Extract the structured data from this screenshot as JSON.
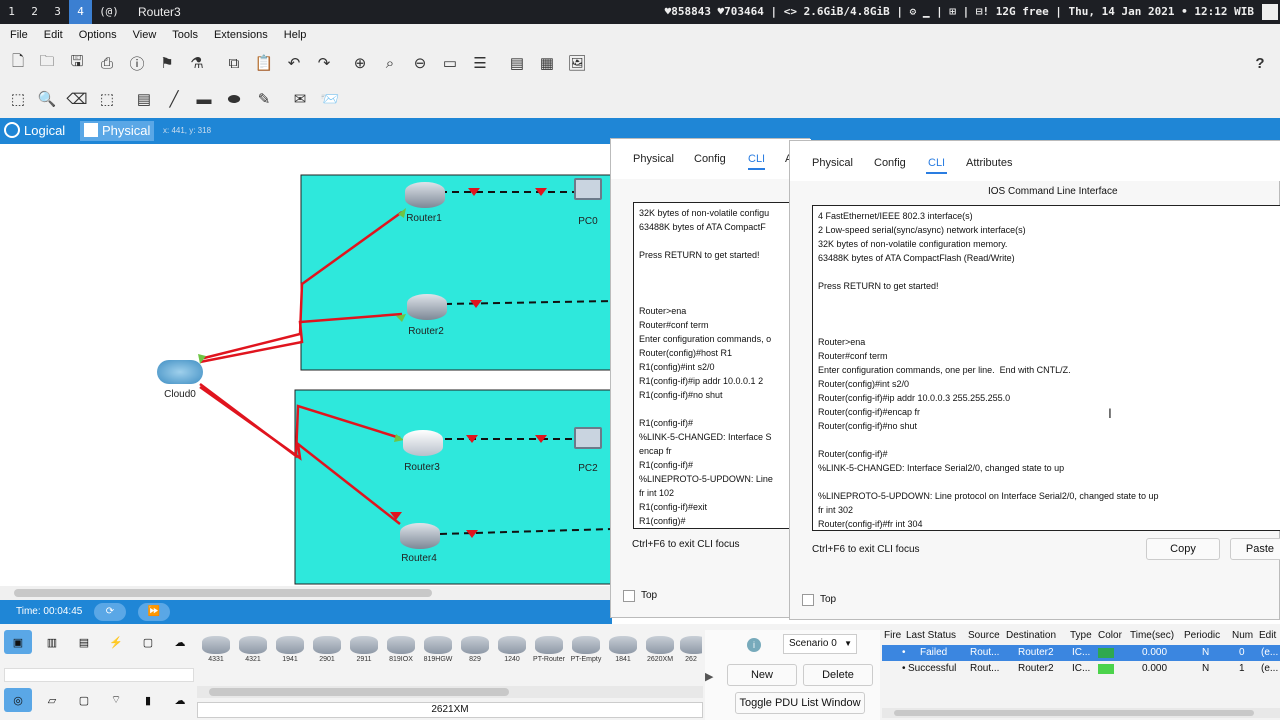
{
  "system_bar": {
    "workspaces": [
      "1",
      "2",
      "3",
      "4",
      "(@)"
    ],
    "active_workspace": "4",
    "window_title": "Router3",
    "status": "♥858843 ♥703464 | <> 2.6GiB/4.8GiB | ⚙ ▁ | ⊞ | ⊟! 12G free | Thu, 14 Jan 2021 • 12:12 WIB"
  },
  "menu": [
    "File",
    "Edit",
    "Options",
    "View",
    "Tools",
    "Extensions",
    "Help"
  ],
  "toolbar_help": "?",
  "workspace_tabs": {
    "logical": "Logical",
    "physical": "Physical",
    "coords": "x: 441, y: 318"
  },
  "devices": {
    "router1": "Router1",
    "router2": "Router2",
    "router3": "Router3",
    "router4": "Router4",
    "pc0": "PC0",
    "pc2": "PC2",
    "cloud": "Cloud0"
  },
  "time_bar": {
    "time": "Time: 00:04:45"
  },
  "device_models": [
    "4331",
    "4321",
    "1941",
    "2901",
    "2911",
    "819IOX",
    "819HGW",
    "829",
    "1240",
    "PT-Router",
    "PT-Empty",
    "1841",
    "2620XM",
    "262"
  ],
  "selected_model": "2621XM",
  "window_back": {
    "tabs": [
      "Physical",
      "Config",
      "CLI",
      "A"
    ],
    "active_tab": "CLI",
    "cli_text": "32K bytes of non-volatile configu\n63488K bytes of ATA CompactF\n\nPress RETURN to get started!\n\n\n\nRouter>ena\nRouter#conf term\nEnter configuration commands, o\nRouter(config)#host R1\nR1(config)#int s2/0\nR1(config-if)#ip addr 10.0.0.1 2\nR1(config-if)#no shut\n\nR1(config-if)#\n%LINK-5-CHANGED: Interface S\nencap fr\nR1(config-if)#\n%LINEPROTO-5-UPDOWN: Line\nfr int 102\nR1(config-if)#exit\nR1(config)#",
    "focus_hint": "Ctrl+F6 to exit CLI focus",
    "top_label": "Top"
  },
  "window_front": {
    "tabs": [
      "Physical",
      "Config",
      "CLI",
      "Attributes"
    ],
    "active_tab": "CLI",
    "cli_title": "IOS Command Line Interface",
    "cli_text": "4 FastEthernet/IEEE 802.3 interface(s)\n2 Low-speed serial(sync/async) network interface(s)\n32K bytes of non-volatile configuration memory.\n63488K bytes of ATA CompactFlash (Read/Write)\n\nPress RETURN to get started!\n\n\n\nRouter>ena\nRouter#conf term\nEnter configuration commands, one per line.  End with CNTL/Z.\nRouter(config)#int s2/0\nRouter(config-if)#ip addr 10.0.0.3 255.255.255.0\nRouter(config-if)#encap fr\nRouter(config-if)#no shut\n\nRouter(config-if)#\n%LINK-5-CHANGED: Interface Serial2/0, changed state to up\n\n%LINEPROTO-5-UPDOWN: Line protocol on Interface Serial2/0, changed state to up\nfr int 302\nRouter(config-if)#fr int 304",
    "focus_hint": "Ctrl+F6 to exit CLI focus",
    "copy_label": "Copy",
    "paste_label": "Paste",
    "top_label": "Top"
  },
  "scenario": {
    "selected": "Scenario 0",
    "new_label": "New",
    "delete_label": "Delete",
    "toggle_label": "Toggle PDU List Window"
  },
  "pdu_list": {
    "columns": [
      "Fire",
      "Last Status",
      "Source",
      "Destination",
      "Type",
      "Color",
      "Time(sec)",
      "Periodic",
      "Num",
      "Edit"
    ],
    "rows": [
      {
        "fire": "•",
        "status": "Failed",
        "source": "Rout...",
        "destination": "Router2",
        "type": "IC...",
        "color": "#2fa84f",
        "time": "0.000",
        "periodic": "N",
        "num": "0",
        "edit": "(e..."
      },
      {
        "fire": "•",
        "status": "Successful",
        "source": "Rout...",
        "destination": "Router2",
        "type": "IC...",
        "color": "#4bd34b",
        "time": "0.000",
        "periodic": "N",
        "num": "1",
        "edit": "(e..."
      }
    ]
  },
  "colors": {
    "accent": "#1f86d6",
    "link": "#e0141e",
    "area": "#2ee8dc"
  }
}
